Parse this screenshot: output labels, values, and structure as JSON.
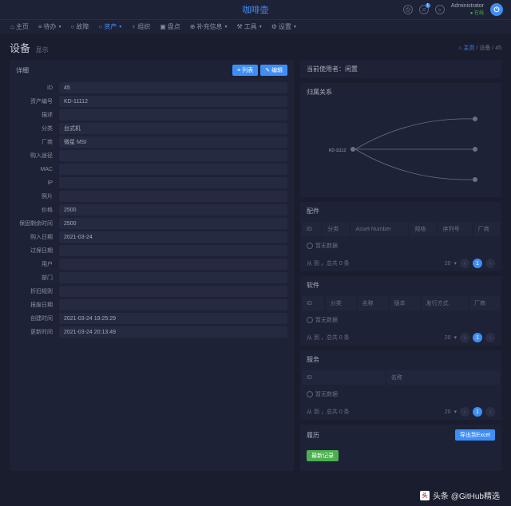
{
  "brand": "咖啡壶",
  "user": {
    "name": "Administrator",
    "status": "● 在线"
  },
  "notif_count": "1",
  "menu": [
    {
      "icon": "⌂",
      "label": "主页"
    },
    {
      "icon": "≡",
      "label": "待办",
      "car": "▾"
    },
    {
      "icon": "○",
      "label": "故障"
    },
    {
      "icon": "○",
      "label": "资产",
      "car": "▾",
      "active": true
    },
    {
      "icon": "♀",
      "label": "组织"
    },
    {
      "icon": "▣",
      "label": "盘点"
    },
    {
      "icon": "⊕",
      "label": "补充信息",
      "car": "▾"
    },
    {
      "icon": "⚒",
      "label": "工具",
      "car": "▾"
    },
    {
      "icon": "⚙",
      "label": "设置",
      "car": "▾"
    }
  ],
  "page": {
    "title": "设备",
    "sub": "显示"
  },
  "crumb": {
    "home": "⌂ 主页",
    "mid": "设备",
    "cur": "45"
  },
  "detail": {
    "title": "详细",
    "btn_list": "≡ 列表",
    "btn_edit": "✎ 编辑",
    "rows": [
      {
        "lbl": "ID",
        "val": "45"
      },
      {
        "lbl": "资产编号",
        "val": "KD-11112"
      },
      {
        "lbl": "描述",
        "val": ""
      },
      {
        "lbl": "分类",
        "val": "台式机"
      },
      {
        "lbl": "厂商",
        "val": "微星 MSI"
      },
      {
        "lbl": "购入途径",
        "val": ""
      },
      {
        "lbl": "MAC",
        "val": ""
      },
      {
        "lbl": "IP",
        "val": ""
      },
      {
        "lbl": "照片",
        "val": ""
      },
      {
        "lbl": "价格",
        "val": "2500"
      },
      {
        "lbl": "保固剩余时间",
        "val": "2500"
      },
      {
        "lbl": "购入日期",
        "val": "2021-03-24"
      },
      {
        "lbl": "过保日期",
        "val": ""
      },
      {
        "lbl": "用户",
        "val": ""
      },
      {
        "lbl": "部门",
        "val": ""
      },
      {
        "lbl": "折旧规则",
        "val": ""
      },
      {
        "lbl": "报废日期",
        "val": ""
      },
      {
        "lbl": "创建时间",
        "val": "2021-03-24 19:25:29"
      },
      {
        "lbl": "更新时间",
        "val": "2021-03-24 20:13:49"
      }
    ]
  },
  "current_user": {
    "title": "当前使用者：闲置"
  },
  "relation": {
    "title": "归属关系",
    "root": "KD-11112"
  },
  "parts": {
    "title": "配件",
    "cols": [
      "ID",
      "分类",
      "Asset Number",
      "规格",
      "序列号",
      "厂商"
    ],
    "empty": "暂无数据",
    "pager_left": "从 到 ，总共 0 条",
    "pp": "20"
  },
  "software": {
    "title": "软件",
    "cols": [
      "ID",
      "分类",
      "名称",
      "版本",
      "发行方式",
      "厂商"
    ],
    "empty": "暂无数据",
    "pager_left": "从 到 ，总共 0 条",
    "pp": "20"
  },
  "service": {
    "title": "服务",
    "cols": [
      "ID",
      "名称"
    ],
    "empty": "暂无数据",
    "pager_left": "从 到 ，总共 0 条",
    "pp": "20"
  },
  "history": {
    "title": "履历",
    "export": "导出到Excel",
    "latest": "最新记录"
  },
  "attr": "头条 @GitHub精选"
}
